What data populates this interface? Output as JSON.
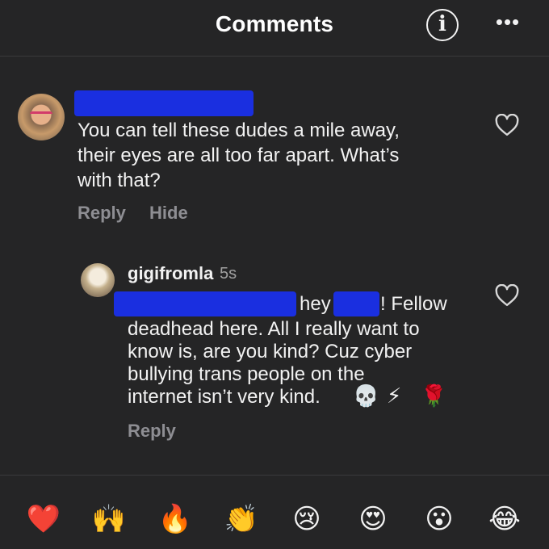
{
  "header": {
    "title": "Comments",
    "info_icon": "info-icon",
    "more_icon": "more-horizontal-icon",
    "info_glyph": "i",
    "more_glyph": "•••"
  },
  "comments": [
    {
      "username_redacted": true,
      "lines": [
        "You can tell these dudes a mile away,",
        "their eyes are all too far apart. What’s",
        "with that?"
      ],
      "actions": {
        "reply": "Reply",
        "hide": "Hide"
      },
      "like_icon": "heart-outline-icon"
    },
    {
      "username": "gigifromla",
      "time": "5s",
      "line1_a": "hey",
      "line1_b": "! Fellow",
      "lines": [
        "deadhead here. All I really want to",
        "know is, are you kind? Cuz cyber",
        "bullying trans people on the",
        "internet isn’t very kind."
      ],
      "trailing_emojis": [
        "💀",
        "⚡",
        "🌹"
      ],
      "actions": {
        "reply": "Reply"
      },
      "like_icon": "heart-outline-icon"
    }
  ],
  "emoji_bar": [
    "❤️",
    "🙌",
    "🔥",
    "👏",
    "😢",
    "😍",
    "😮",
    "😂"
  ],
  "colors": {
    "background": "#252526",
    "text": "#f2f2f2",
    "secondary": "#8e8e93",
    "redaction": "#1a2fe0"
  }
}
